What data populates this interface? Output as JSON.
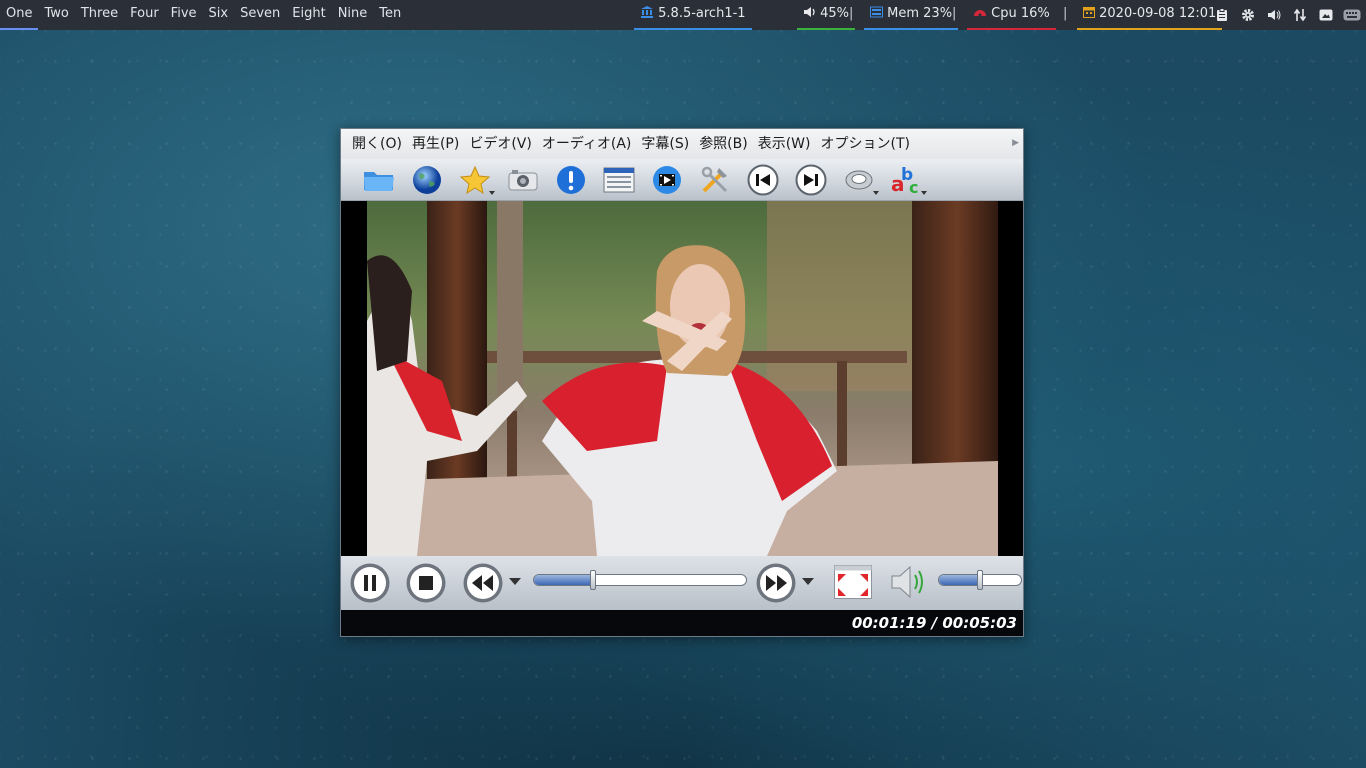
{
  "desktop": {
    "workspaces": [
      "One",
      "Two",
      "Three",
      "Four",
      "Five",
      "Six",
      "Seven",
      "Eight",
      "Nine",
      "Ten"
    ],
    "active_workspace": "One",
    "kernel": "5.8.5-arch1-1",
    "volume": "45%",
    "mem": "Mem 23%",
    "cpu": "Cpu  16%",
    "datetime": "2020-09-08 12:01",
    "separator": "|",
    "colors": {
      "kernel": "#3a8ee6",
      "volume": "#3db13d",
      "mem": "#3a8ee6",
      "cpu": "#d6263a",
      "date": "#e2a21c"
    },
    "tray_icons": [
      "clipboard-icon",
      "gear-icon",
      "speaker-icon",
      "network-arrows-icon",
      "display-icon",
      "keyboard-icon"
    ]
  },
  "player": {
    "menu": [
      {
        "label": "開く(O)"
      },
      {
        "label": "再生(P)"
      },
      {
        "label": "ビデオ(V)"
      },
      {
        "label": "オーディオ(A)"
      },
      {
        "label": "字幕(S)"
      },
      {
        "label": "参照(B)"
      },
      {
        "label": "表示(W)"
      },
      {
        "label": "オプション(T)"
      }
    ],
    "toolbar_icons": [
      "folder-icon",
      "globe-icon",
      "star-icon",
      "camera-icon",
      "info-icon",
      "playlist-icon",
      "video-file-icon",
      "tools-icon",
      "previous-icon",
      "next-icon",
      "audio-track-icon",
      "subtitles-icon"
    ],
    "seek_progress": 0.28,
    "volume_level": 0.5,
    "time_current": "00:01:19",
    "time_total": "00:05:03",
    "time_sep": " / "
  }
}
